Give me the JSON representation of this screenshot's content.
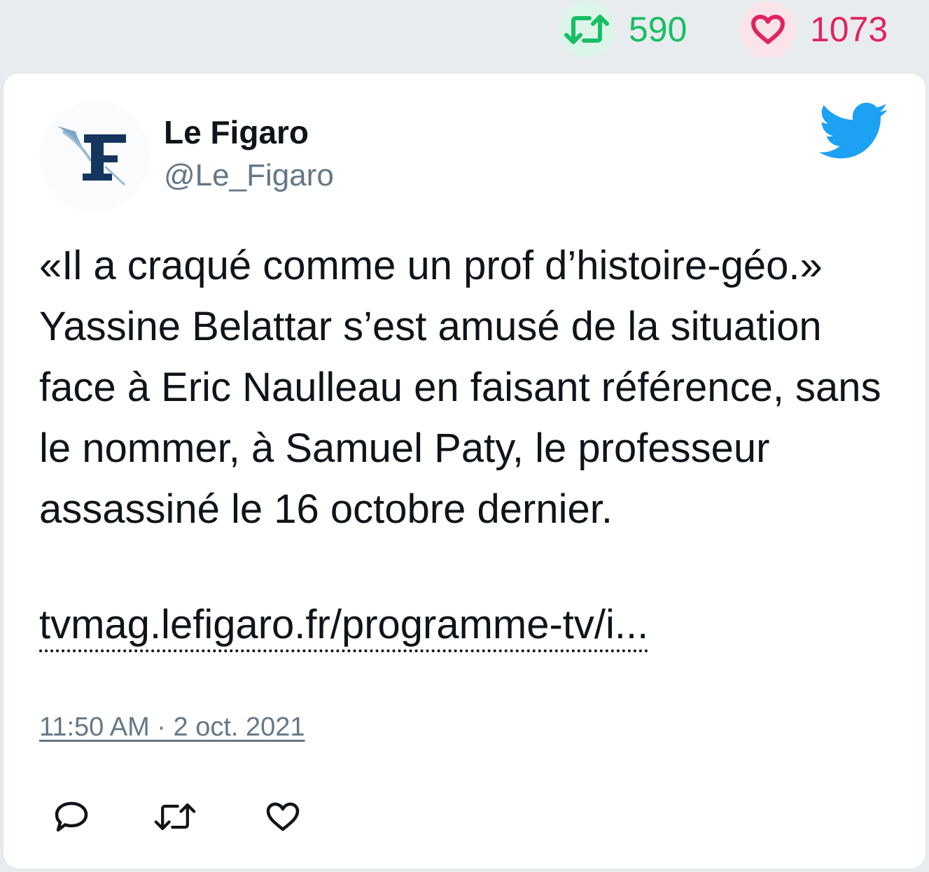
{
  "stats": {
    "retweets": "590",
    "likes": "1073"
  },
  "author": {
    "name": "Le Figaro",
    "handle": "@Le_Figaro"
  },
  "tweet": {
    "text": "«Il a craqué comme un prof d’histoire-géo.» Yassine Belattar s’est amusé de la situation face à Eric Naulleau en faisant référence, sans le nommer, à Samuel Paty, le professeur assassiné le 16 octobre dernier.",
    "link": "tvmag.lefigaro.fr/programme-tv/i...",
    "timestamp": "11:50 AM · 2 oct. 2021"
  },
  "colors": {
    "retweet_green": "#17bf63",
    "like_red": "#e0245e",
    "twitter_blue": "#1da1f2",
    "handle_gray": "#657786"
  },
  "icons": {
    "stat_retweet": "retweet-icon",
    "stat_like": "heart-icon",
    "brand": "twitter-bird-icon",
    "reply": "reply-icon",
    "retweet": "retweet-icon",
    "like": "heart-icon"
  }
}
